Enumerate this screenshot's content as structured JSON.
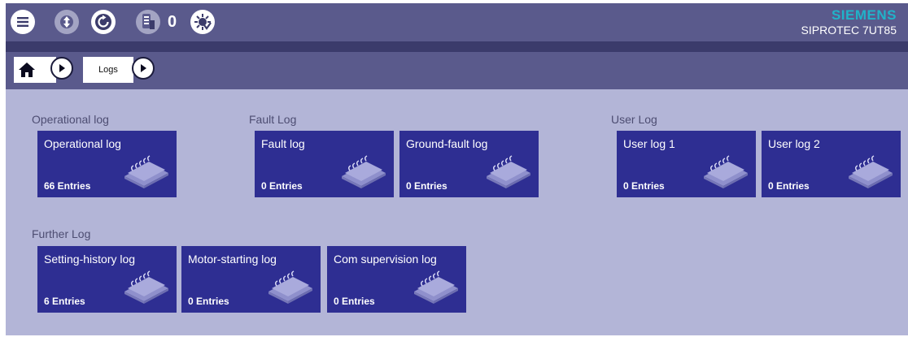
{
  "topbar": {
    "counter": "0",
    "brand_logo": "SIEMENS",
    "device": "SIPROTEC 7UT85",
    "buttons": [
      "menu-icon",
      "load-config-icon",
      "refresh-icon",
      "device-icon",
      "led-icon"
    ]
  },
  "breadcrumb": {
    "current": "Logs"
  },
  "sections": {
    "operational": {
      "title": "Operational log",
      "tiles": [
        {
          "name": "Operational log",
          "count": "66 Entries"
        }
      ]
    },
    "fault": {
      "title": "Fault Log",
      "tiles": [
        {
          "name": "Fault log",
          "count": "0 Entries"
        },
        {
          "name": "Ground-fault log",
          "count": "0 Entries"
        }
      ]
    },
    "user": {
      "title": "User Log",
      "tiles": [
        {
          "name": "User log 1",
          "count": "0 Entries"
        },
        {
          "name": "User log 2",
          "count": "0 Entries"
        }
      ]
    },
    "further": {
      "title": "Further Log",
      "tiles": [
        {
          "name": "Setting-history log",
          "count": "6 Entries"
        },
        {
          "name": "Motor-starting log",
          "count": "0 Entries"
        },
        {
          "name": "Com supervision log",
          "count": "0 Entries"
        }
      ]
    }
  },
  "colors": {
    "tile": "#2e2e92",
    "topbar": "#5a5a8c",
    "background": "#b3b5d7",
    "brand": "#20b3c9"
  }
}
